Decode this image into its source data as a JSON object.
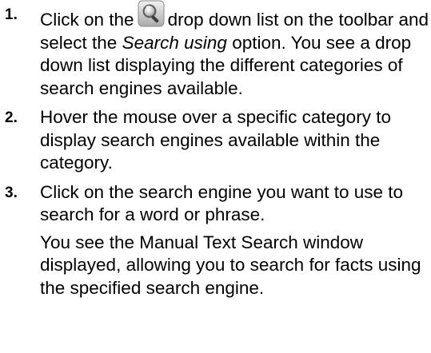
{
  "steps": [
    {
      "number": "1.",
      "before_icon": "Click on the",
      "icon": "search-magnifier-icon",
      "after_icon": "drop down list on the toolbar and select the",
      "emphasis": "Search using",
      "after_emphasis": "option. You see a drop down list displaying the different categories of search engines available."
    },
    {
      "number": "2.",
      "text": "Hover the mouse over a specific category to display search engines available within the category."
    },
    {
      "number": "3.",
      "text": "Click on the search engine you want to use to search for a word or phrase.",
      "note": "You see the Manual Text Search window displayed, allowing you to search for facts using the specified search engine."
    }
  ],
  "colors": {
    "text": "#000000",
    "background": "#ffffff",
    "icon_button": "#b8b8b8"
  }
}
